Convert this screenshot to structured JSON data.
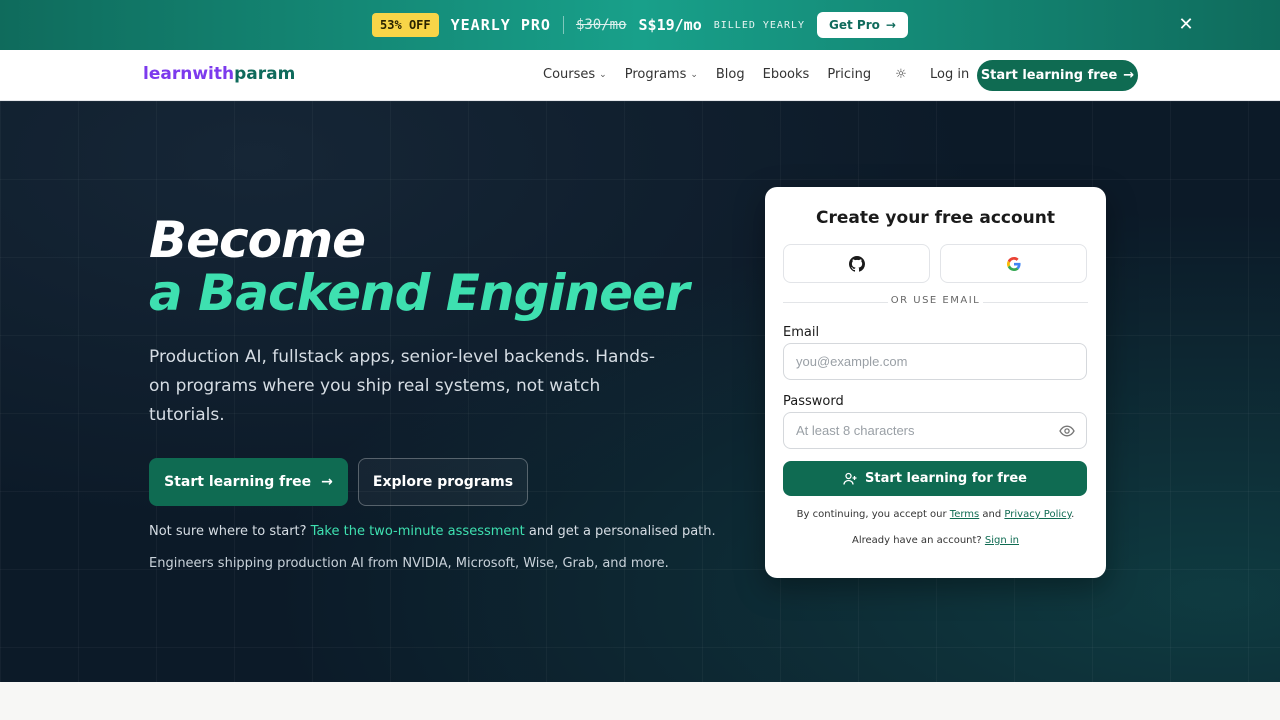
{
  "promo": {
    "badge": "53% OFF",
    "plan": "YEARLY PRO",
    "old_price": "$30/mo",
    "new_price": "S$19/mo",
    "billed": "BILLED YEARLY",
    "cta": "Get Pro",
    "close_icon": "close-icon"
  },
  "nav": {
    "logo_part1": "learnwith",
    "logo_part2": "param",
    "links": [
      "Courses",
      "Programs",
      "Blog",
      "Ebooks",
      "Pricing"
    ],
    "login": "Log in",
    "cta": "Start learning free"
  },
  "hero": {
    "title_line1": "Become",
    "title_line2": "a Backend Engineer",
    "subtitle": "Production AI, fullstack apps, senior-level backends. Hands-on programs where you ship real systems, not watch tutorials.",
    "primary_cta": "Start learning free",
    "secondary_cta": "Explore programs",
    "assess_prefix": "Not sure where to start? ",
    "assess_link": "Take the two-minute assessment",
    "assess_suffix": " and get a personalised path.",
    "trusted": "Engineers shipping production AI from NVIDIA, Microsoft, Wise, Grab, and more."
  },
  "signup": {
    "title": "Create your free account",
    "divider": "OR USE EMAIL",
    "email_label": "Email",
    "email_placeholder": "you@example.com",
    "password_label": "Password",
    "password_placeholder": "At least 8 characters",
    "submit": "Start learning for free",
    "legal_prefix": "By continuing, you accept our ",
    "terms": "Terms",
    "legal_and": " and ",
    "privacy": "Privacy Policy",
    "legal_suffix": ".",
    "signin_prefix": "Already have an account? ",
    "signin_link": "Sign in"
  },
  "colors": {
    "accent": "#0f6b52",
    "highlight": "#3ee0b0",
    "logo_purple": "#7c3aed",
    "hero_bg": "#0c1a28"
  }
}
